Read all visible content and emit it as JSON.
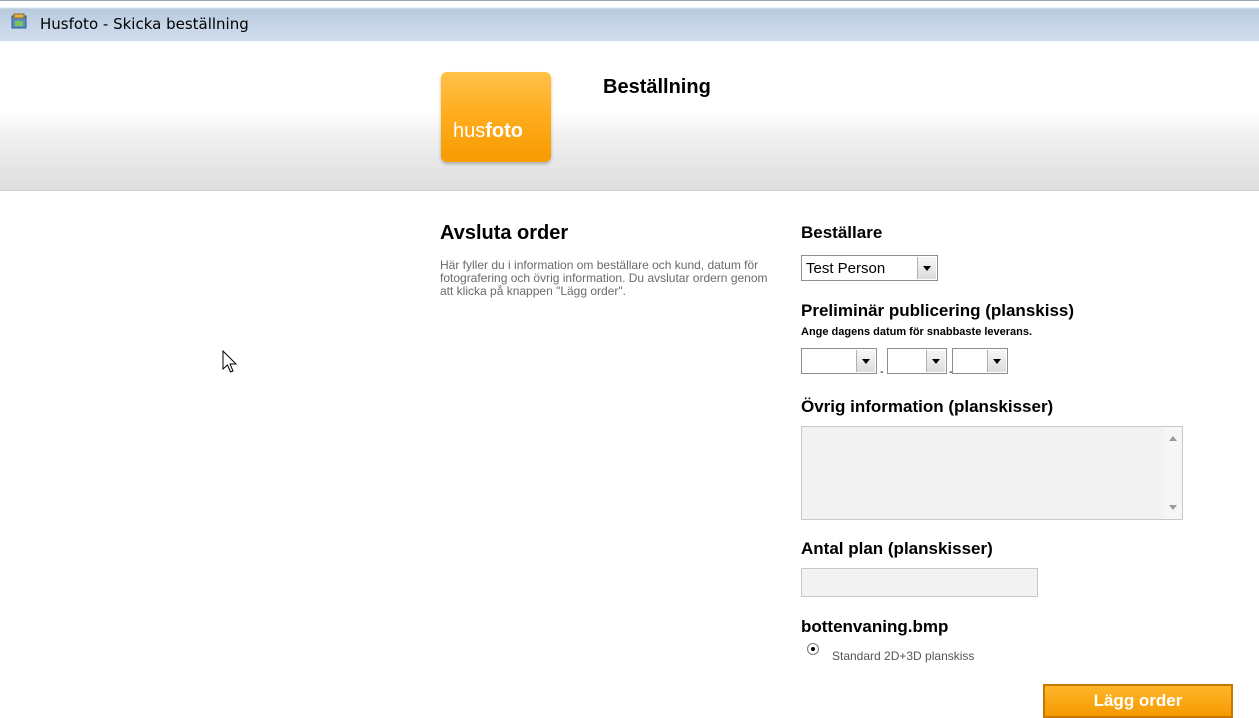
{
  "window": {
    "title": "Husfoto - Skicka beställning",
    "icon": "app-icon"
  },
  "header": {
    "logo_text_plain": "hus",
    "logo_text_bold": "foto",
    "heading": "Beställning"
  },
  "left": {
    "heading": "Avsluta order",
    "description": "Här fyller du i information om beställare och kund, datum för fotografering och övrig information. Du avslutar ordern genom att klicka på knappen \"Lägg order\"."
  },
  "form": {
    "orderer_label": "Beställare",
    "orderer_value": "Test Person",
    "publish_label": "Preliminär publicering (planskiss)",
    "publish_hint": "Ange dagens datum för snabbaste leverans.",
    "date_separator": "-",
    "other_info_label": "Övrig information (planskisser)",
    "floors_label": "Antal plan (planskisser)",
    "file_label": "bottenvaning.bmp",
    "option_label": "Standard 2D+3D planskiss",
    "submit_label": "Lägg order"
  },
  "colors": {
    "accent": "#f7a000",
    "titlebar": "#c6d6e8"
  }
}
